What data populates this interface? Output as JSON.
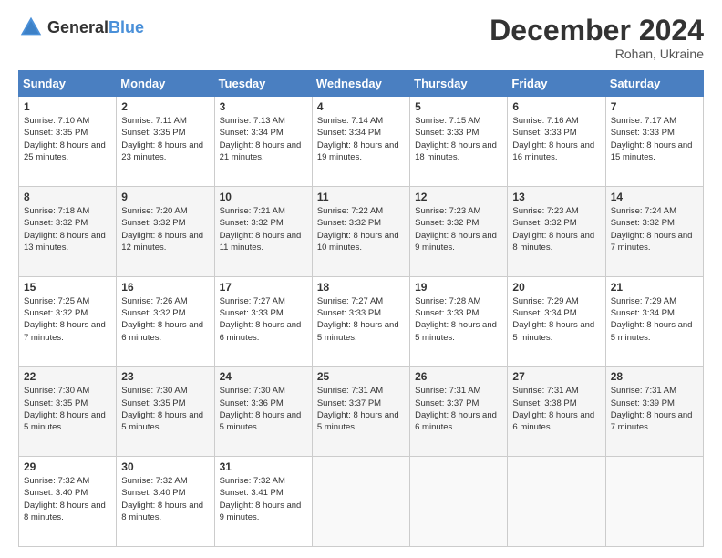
{
  "logo": {
    "general": "General",
    "blue": "Blue"
  },
  "header": {
    "month": "December 2024",
    "location": "Rohan, Ukraine"
  },
  "days_of_week": [
    "Sunday",
    "Monday",
    "Tuesday",
    "Wednesday",
    "Thursday",
    "Friday",
    "Saturday"
  ],
  "weeks": [
    [
      {
        "day": "1",
        "sunrise": "7:10 AM",
        "sunset": "3:35 PM",
        "daylight": "8 hours and 25 minutes."
      },
      {
        "day": "2",
        "sunrise": "7:11 AM",
        "sunset": "3:35 PM",
        "daylight": "8 hours and 23 minutes."
      },
      {
        "day": "3",
        "sunrise": "7:13 AM",
        "sunset": "3:34 PM",
        "daylight": "8 hours and 21 minutes."
      },
      {
        "day": "4",
        "sunrise": "7:14 AM",
        "sunset": "3:34 PM",
        "daylight": "8 hours and 19 minutes."
      },
      {
        "day": "5",
        "sunrise": "7:15 AM",
        "sunset": "3:33 PM",
        "daylight": "8 hours and 18 minutes."
      },
      {
        "day": "6",
        "sunrise": "7:16 AM",
        "sunset": "3:33 PM",
        "daylight": "8 hours and 16 minutes."
      },
      {
        "day": "7",
        "sunrise": "7:17 AM",
        "sunset": "3:33 PM",
        "daylight": "8 hours and 15 minutes."
      }
    ],
    [
      {
        "day": "8",
        "sunrise": "7:18 AM",
        "sunset": "3:32 PM",
        "daylight": "8 hours and 13 minutes."
      },
      {
        "day": "9",
        "sunrise": "7:20 AM",
        "sunset": "3:32 PM",
        "daylight": "8 hours and 12 minutes."
      },
      {
        "day": "10",
        "sunrise": "7:21 AM",
        "sunset": "3:32 PM",
        "daylight": "8 hours and 11 minutes."
      },
      {
        "day": "11",
        "sunrise": "7:22 AM",
        "sunset": "3:32 PM",
        "daylight": "8 hours and 10 minutes."
      },
      {
        "day": "12",
        "sunrise": "7:23 AM",
        "sunset": "3:32 PM",
        "daylight": "8 hours and 9 minutes."
      },
      {
        "day": "13",
        "sunrise": "7:23 AM",
        "sunset": "3:32 PM",
        "daylight": "8 hours and 8 minutes."
      },
      {
        "day": "14",
        "sunrise": "7:24 AM",
        "sunset": "3:32 PM",
        "daylight": "8 hours and 7 minutes."
      }
    ],
    [
      {
        "day": "15",
        "sunrise": "7:25 AM",
        "sunset": "3:32 PM",
        "daylight": "8 hours and 7 minutes."
      },
      {
        "day": "16",
        "sunrise": "7:26 AM",
        "sunset": "3:32 PM",
        "daylight": "8 hours and 6 minutes."
      },
      {
        "day": "17",
        "sunrise": "7:27 AM",
        "sunset": "3:33 PM",
        "daylight": "8 hours and 6 minutes."
      },
      {
        "day": "18",
        "sunrise": "7:27 AM",
        "sunset": "3:33 PM",
        "daylight": "8 hours and 5 minutes."
      },
      {
        "day": "19",
        "sunrise": "7:28 AM",
        "sunset": "3:33 PM",
        "daylight": "8 hours and 5 minutes."
      },
      {
        "day": "20",
        "sunrise": "7:29 AM",
        "sunset": "3:34 PM",
        "daylight": "8 hours and 5 minutes."
      },
      {
        "day": "21",
        "sunrise": "7:29 AM",
        "sunset": "3:34 PM",
        "daylight": "8 hours and 5 minutes."
      }
    ],
    [
      {
        "day": "22",
        "sunrise": "7:30 AM",
        "sunset": "3:35 PM",
        "daylight": "8 hours and 5 minutes."
      },
      {
        "day": "23",
        "sunrise": "7:30 AM",
        "sunset": "3:35 PM",
        "daylight": "8 hours and 5 minutes."
      },
      {
        "day": "24",
        "sunrise": "7:30 AM",
        "sunset": "3:36 PM",
        "daylight": "8 hours and 5 minutes."
      },
      {
        "day": "25",
        "sunrise": "7:31 AM",
        "sunset": "3:37 PM",
        "daylight": "8 hours and 5 minutes."
      },
      {
        "day": "26",
        "sunrise": "7:31 AM",
        "sunset": "3:37 PM",
        "daylight": "8 hours and 6 minutes."
      },
      {
        "day": "27",
        "sunrise": "7:31 AM",
        "sunset": "3:38 PM",
        "daylight": "8 hours and 6 minutes."
      },
      {
        "day": "28",
        "sunrise": "7:31 AM",
        "sunset": "3:39 PM",
        "daylight": "8 hours and 7 minutes."
      }
    ],
    [
      {
        "day": "29",
        "sunrise": "7:32 AM",
        "sunset": "3:40 PM",
        "daylight": "8 hours and 8 minutes."
      },
      {
        "day": "30",
        "sunrise": "7:32 AM",
        "sunset": "3:40 PM",
        "daylight": "8 hours and 8 minutes."
      },
      {
        "day": "31",
        "sunrise": "7:32 AM",
        "sunset": "3:41 PM",
        "daylight": "8 hours and 9 minutes."
      },
      null,
      null,
      null,
      null
    ]
  ],
  "labels": {
    "sunrise": "Sunrise:",
    "sunset": "Sunset:",
    "daylight": "Daylight:"
  }
}
